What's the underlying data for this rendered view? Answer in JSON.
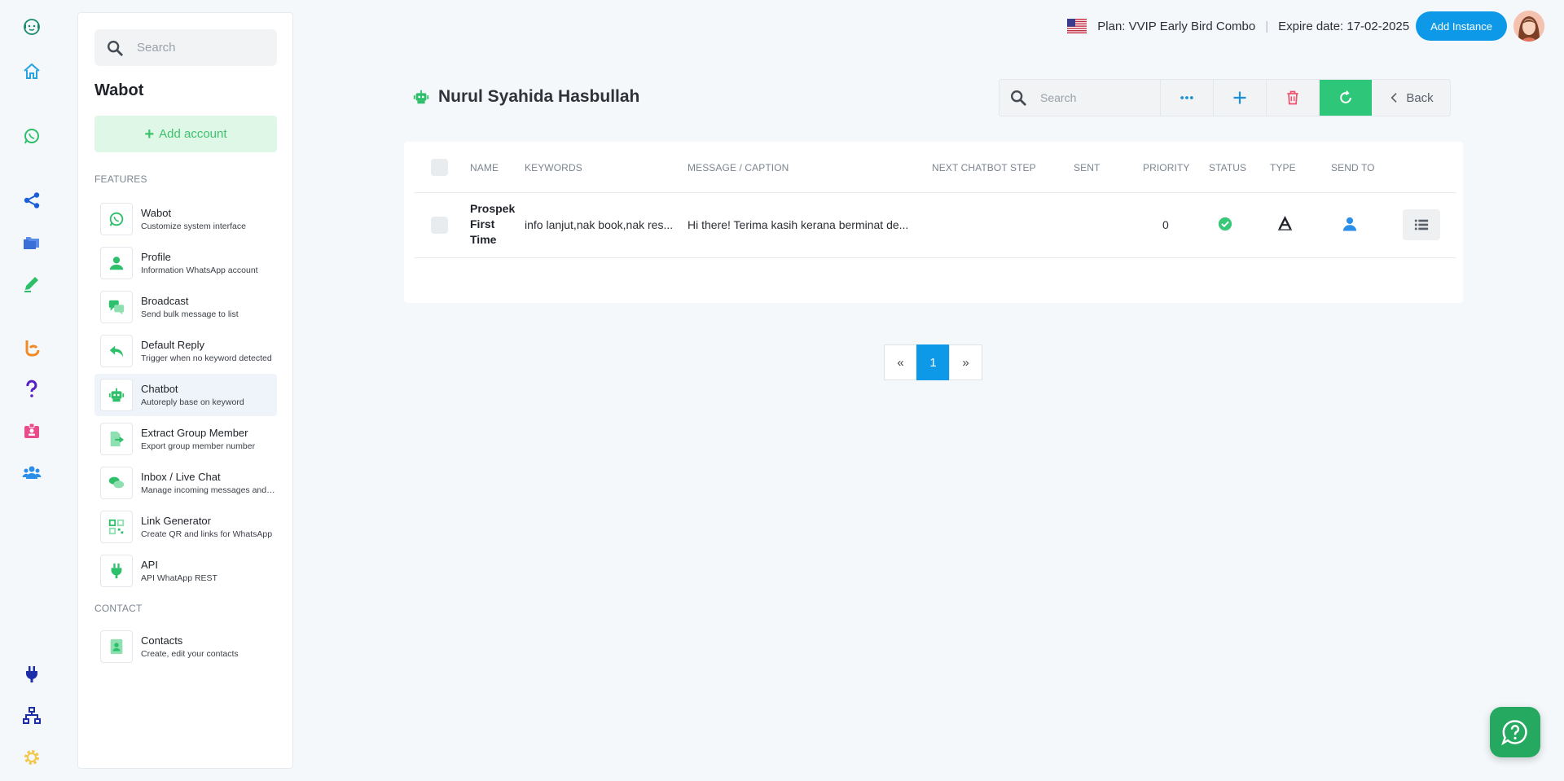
{
  "sidebar": {
    "search_placeholder": "Search",
    "title": "Wabot",
    "add_account_label": "Add account",
    "features_label": "FEATURES",
    "contact_label": "CONTACT",
    "features": [
      {
        "title": "Wabot",
        "desc": "Customize system interface",
        "icon": "whatsapp-icon"
      },
      {
        "title": "Profile",
        "desc": "Information WhatsApp account",
        "icon": "user-icon"
      },
      {
        "title": "Broadcast",
        "desc": "Send bulk message to list",
        "icon": "chat-bubbles-icon"
      },
      {
        "title": "Default Reply",
        "desc": "Trigger when no keyword detected",
        "icon": "reply-icon"
      },
      {
        "title": "Chatbot",
        "desc": "Autoreply base on keyword",
        "icon": "robot-icon"
      },
      {
        "title": "Extract Group Member",
        "desc": "Export group member number",
        "icon": "file-export-icon"
      },
      {
        "title": "Inbox / Live Chat",
        "desc": "Manage incoming messages and chats",
        "icon": "comments-icon"
      },
      {
        "title": "Link Generator",
        "desc": "Create QR and links for WhatsApp",
        "icon": "qrcode-icon"
      },
      {
        "title": "API",
        "desc": "API WhatApp REST",
        "icon": "plug-icon"
      }
    ],
    "contacts": [
      {
        "title": "Contacts",
        "desc": "Create, edit your contacts",
        "icon": "address-book-icon"
      }
    ]
  },
  "topbar": {
    "plan": "Plan: VVIP Early Bird Combo",
    "separator": "|",
    "expire": "Expire date: 17-02-2025",
    "add_instance_label": "Add Instance"
  },
  "page": {
    "title": "Nurul Syahida Hasbullah"
  },
  "toolbar": {
    "search_placeholder": "Search",
    "back_label": "Back"
  },
  "table": {
    "columns": [
      "NAME",
      "KEYWORDS",
      "MESSAGE / CAPTION",
      "NEXT CHATBOT STEP",
      "SENT",
      "PRIORITY",
      "STATUS",
      "TYPE",
      "SEND TO"
    ],
    "rows": [
      {
        "name": "Prospek First Time",
        "keywords": "info lanjut,nak book,nak res...",
        "message": "Hi there! Terima kasih kerana berminat de...",
        "next_step": "",
        "sent": "",
        "priority": "0",
        "status": "active",
        "type": "text",
        "send_to": "user"
      }
    ]
  },
  "pagination": {
    "prev": "«",
    "pages": [
      "1"
    ],
    "next": "»",
    "current": "1"
  },
  "colors": {
    "accent_blue": "#0d99e8",
    "brand_green": "#2ec77a",
    "icon_green": "#3cc36b"
  }
}
